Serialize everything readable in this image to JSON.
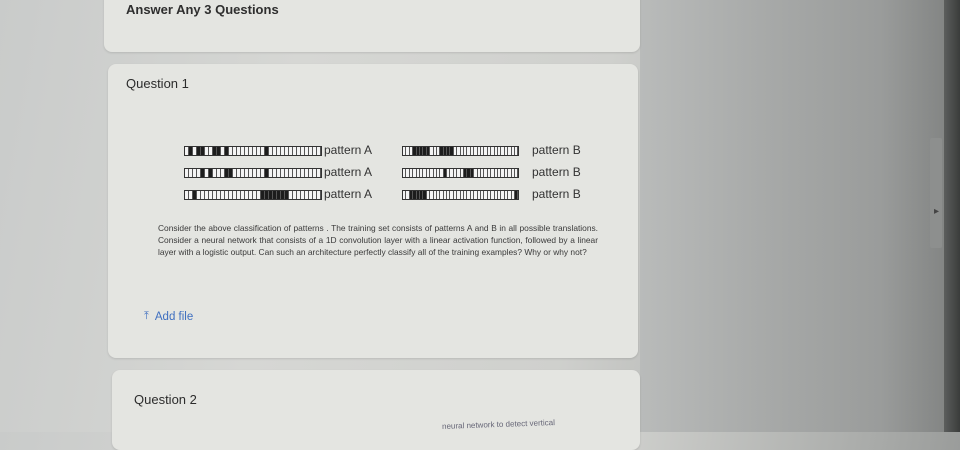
{
  "header": {
    "title": "Answer Any 3 Questions"
  },
  "question1": {
    "title": "Question 1",
    "patterns": [
      {
        "label": "pattern A",
        "cells": [
          0,
          1,
          0,
          1,
          1,
          0,
          0,
          1,
          1,
          0,
          1,
          0,
          0,
          0,
          0,
          0,
          0,
          0,
          0,
          0,
          1,
          0,
          0,
          0,
          0,
          0,
          0,
          0,
          0,
          0,
          0,
          0,
          0,
          0
        ]
      },
      {
        "label": "pattern A",
        "cells": [
          0,
          0,
          0,
          0,
          1,
          0,
          1,
          0,
          0,
          0,
          1,
          1,
          0,
          0,
          0,
          0,
          0,
          0,
          0,
          0,
          1,
          0,
          0,
          0,
          0,
          0,
          0,
          0,
          0,
          0,
          0,
          0,
          0,
          0
        ]
      },
      {
        "label": "pattern A",
        "cells": [
          0,
          0,
          1,
          0,
          0,
          0,
          0,
          0,
          0,
          0,
          0,
          0,
          0,
          0,
          0,
          0,
          0,
          0,
          0,
          1,
          1,
          1,
          1,
          1,
          1,
          1,
          0,
          0,
          0,
          0,
          0,
          0,
          0,
          0
        ]
      },
      {
        "label": "pattern B",
        "cells": [
          0,
          0,
          0,
          1,
          1,
          1,
          1,
          1,
          0,
          0,
          0,
          1,
          1,
          1,
          1,
          0,
          0,
          0,
          0,
          0,
          0,
          0,
          0,
          0,
          0,
          0,
          0,
          0,
          0,
          0,
          0,
          0,
          0,
          0
        ]
      },
      {
        "label": "pattern B",
        "cells": [
          0,
          0,
          0,
          0,
          0,
          0,
          0,
          0,
          0,
          0,
          0,
          0,
          1,
          0,
          0,
          0,
          0,
          0,
          1,
          1,
          1,
          0,
          0,
          0,
          0,
          0,
          0,
          0,
          0,
          0,
          0,
          0,
          0,
          0
        ]
      },
      {
        "label": "pattern B",
        "cells": [
          0,
          0,
          1,
          1,
          1,
          1,
          1,
          0,
          0,
          0,
          0,
          0,
          0,
          0,
          0,
          0,
          0,
          0,
          0,
          0,
          0,
          0,
          0,
          0,
          0,
          0,
          0,
          0,
          0,
          0,
          0,
          0,
          0,
          1
        ]
      }
    ],
    "text": "Consider the above classification of patterns . The training set consists of patterns A and B in all possible translations. Consider a neural network that consists of a 1D convolution layer with a linear activation function, followed by a linear layer with a logistic output. Can such an architecture perfectly classify all of the training examples? Why or why not?",
    "add_file_label": "Add file",
    "add_file_icon": "upload-icon"
  },
  "question2": {
    "title": "Question 2",
    "snippet": "neural network to detect vertical"
  },
  "colors": {
    "card": "#e4e5e1",
    "link": "#3f6fc0",
    "text": "#2e2e2e"
  }
}
